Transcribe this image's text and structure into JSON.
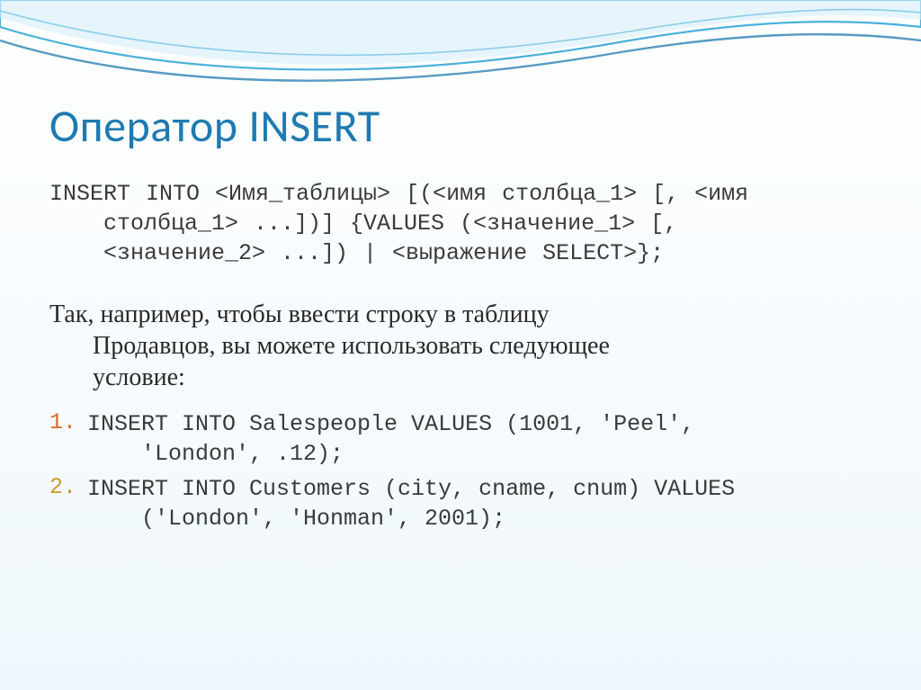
{
  "slide": {
    "title": "Оператор INSERT",
    "syntax": {
      "l1": "INSERT INTO <Имя_таблицы> [(<имя столбца_1> [, <имя",
      "l2": "столбца_1> ...])] {VALUES (<значение_1> [,",
      "l3": "<значение_2> ...]) | <выражение SELECT>};"
    },
    "paragraph": {
      "l1": "Так, например, чтобы ввести строку в таблицу",
      "l2": "Продавцов, вы можете использовать следующее",
      "l3": "условие:"
    },
    "examples": [
      {
        "num": "1.",
        "l1": "INSERT INTO Salespeople VALUES (1001, 'Peel',",
        "l2": "'London', .12);"
      },
      {
        "num": "2.",
        "l1": "INSERT INTO Customers (city, cname, cnum) VALUES",
        "l2": "('London', 'Honman', 2001);"
      }
    ]
  }
}
